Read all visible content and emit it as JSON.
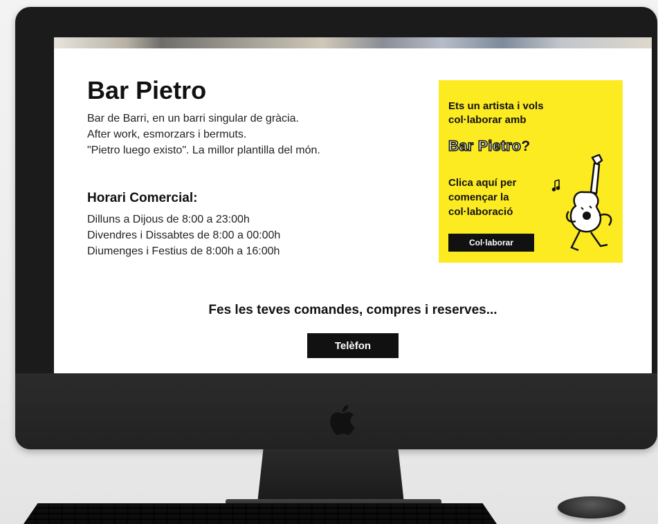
{
  "page": {
    "title": "Bar Pietro",
    "description": [
      "Bar de Barri, en un barri singular de gràcia.",
      "After work, esmorzars i bermuts.",
      "\"Pietro luego existo\". La millor plantilla del món."
    ],
    "hours_title": "Horari Comercial:",
    "hours": [
      "Dilluns a Dijous de 8:00 a 23:00h",
      "Divendres i Dissabtes de 8:00 a 00:00h",
      "Diumenges i Festius de 8:00h a 16:00h"
    ],
    "cta_heading": "Fes les teves comandes, compres i reserves...",
    "phone_button": "Telèfon"
  },
  "promo": {
    "question_line1": "Ets un artista i vols",
    "question_line2": "col·laborar amb",
    "name": "Bar Pietro",
    "qmark": "?",
    "cta_line1": "Clica aquí per",
    "cta_line2": "començar la",
    "cta_line3": "col·laboració",
    "button": "Col·laborar"
  },
  "colors": {
    "promo_bg": "#fdeb22",
    "button_bg": "#111111",
    "text": "#111111",
    "screen_bg": "#ffffff",
    "bezel": "#1b1b1b"
  },
  "icons": [
    "apple-logo-icon",
    "guitar-character-icon",
    "music-notes-icon"
  ]
}
